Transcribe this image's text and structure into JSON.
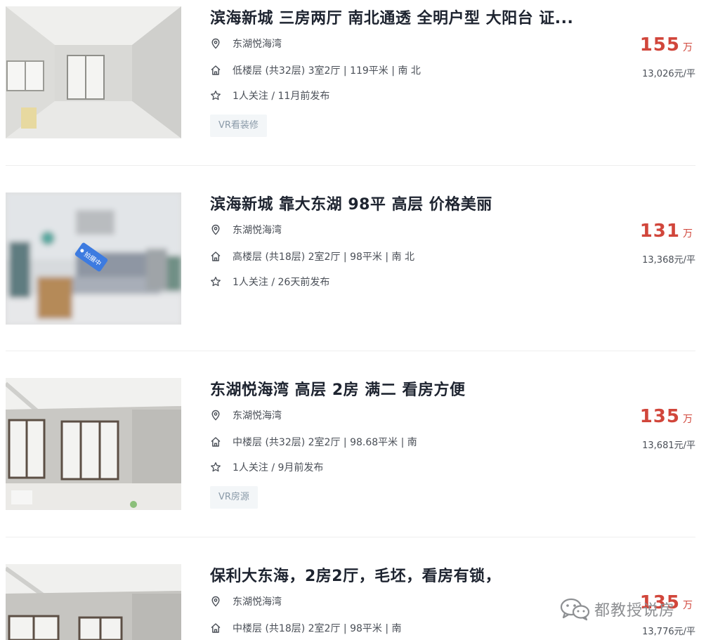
{
  "listings": [
    {
      "title": "滨海新城 三房两厅 南北通透 全明户型 大阳台 证...",
      "community": "东湖悦海湾",
      "info": "低楼层 (共32层) 3室2厅 | 119平米 | 南 北",
      "follow": "1人关注 / 11月前发布",
      "tag": "VR看装修",
      "price": "155",
      "price_unit": "万",
      "unit_price": "13,026元/平"
    },
    {
      "title": "滨海新城 靠大东湖 98平 高层 价格美丽",
      "community": "东湖悦海湾",
      "info": "高楼层 (共18层) 2室2厅 | 98平米 | 南 北",
      "follow": "1人关注 / 26天前发布",
      "tag": "",
      "thumb_badge": "拍摄中",
      "price": "131",
      "price_unit": "万",
      "unit_price": "13,368元/平"
    },
    {
      "title": "东湖悦海湾 高层 2房 满二 看房方便",
      "community": "东湖悦海湾",
      "info": "中楼层 (共32层) 2室2厅 | 98.68平米 | 南",
      "follow": "1人关注 / 9月前发布",
      "tag": "VR房源",
      "price": "135",
      "price_unit": "万",
      "unit_price": "13,681元/平"
    },
    {
      "title": "保利大东海，2房2厅，毛坯，看房有锁，",
      "community": "东湖悦海湾",
      "info": "中楼层 (共18层) 2室2厅 | 98平米 | 南",
      "follow": "",
      "tag": "",
      "price": "135",
      "price_unit": "万",
      "unit_price": "13,776元/平"
    }
  ],
  "watermark": {
    "text": "都教授说房",
    "icon": "wechat-icon"
  },
  "icons": {
    "community": "location-pin-icon",
    "info": "house-icon",
    "follow": "star-icon"
  },
  "colors": {
    "price": "#d1463b",
    "title": "#1e2430",
    "meta": "#4a4f57",
    "tag_bg": "#f3f6f8",
    "tag_text": "#8a9aa8"
  }
}
